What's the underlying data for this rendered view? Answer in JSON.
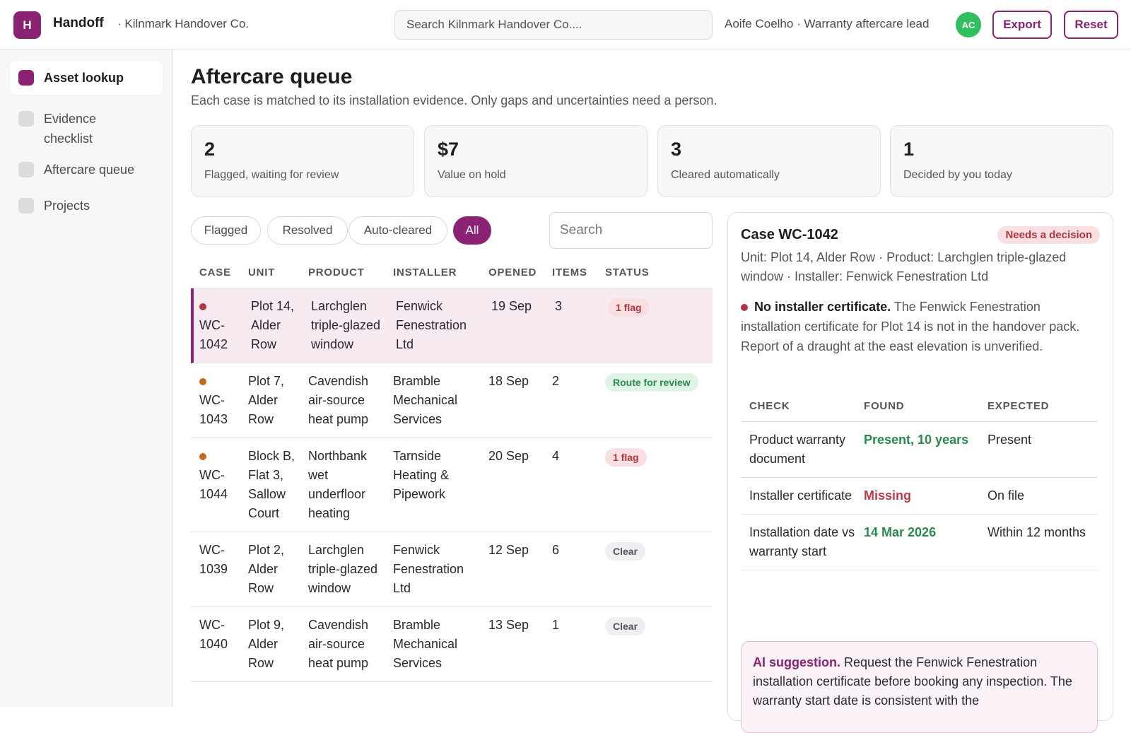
{
  "app": {
    "logo_letter": "H",
    "name": "Handoff",
    "org": "· Kilnmark Handover Co."
  },
  "header": {
    "search_placeholder": "Search Kilnmark Handover Co....",
    "user": "Aoife Coelho · Warranty aftercare lead",
    "avatar_initials": "AC",
    "export_label": "Export",
    "reset_label": "Reset"
  },
  "sidebar": {
    "items": [
      {
        "label": "Asset lookup",
        "active": true
      },
      {
        "label": "Evidence checklist",
        "active": false
      },
      {
        "label": "Aftercare queue",
        "active": false
      },
      {
        "label": "Projects",
        "active": false
      }
    ]
  },
  "page": {
    "title": "Aftercare queue",
    "subtitle": "Each case is matched to its installation evidence. Only gaps and uncertainties need a person."
  },
  "stats": [
    {
      "value": "2",
      "label": "Flagged, waiting for review"
    },
    {
      "value": "$7",
      "label": "Value on hold"
    },
    {
      "value": "3",
      "label": "Cleared automatically"
    },
    {
      "value": "1",
      "label": "Decided by you today"
    }
  ],
  "filters": [
    "Flagged",
    "Resolved",
    "Auto-cleared",
    "All"
  ],
  "active_filter": "All",
  "list_search_placeholder": "Search",
  "table": {
    "columns": [
      "CASE",
      "UNIT",
      "PRODUCT",
      "INSTALLER",
      "OPENED",
      "ITEMS",
      "STATUS"
    ],
    "rows": [
      {
        "case": "WC-1042",
        "unit": "Plot 14, Alder Row",
        "product": "Larchglen triple-glazed window",
        "installer": "Fenwick Fenestration Ltd",
        "opened": "19 Sep",
        "items": "3",
        "status": "1 flag",
        "status_kind": "flag",
        "dot": "#b3343f",
        "selected": true
      },
      {
        "case": "WC-1043",
        "unit": "Plot 7, Alder Row",
        "product": "Cavendish air-source heat pump",
        "installer": "Bramble Mechanical Services",
        "opened": "18 Sep",
        "items": "2",
        "status": "Route for review",
        "status_kind": "review",
        "dot": "#c46a1c",
        "selected": false
      },
      {
        "case": "WC-1044",
        "unit": "Block B, Flat 3, Sallow Court",
        "product": "Northbank wet underfloor heating",
        "installer": "Tarnside Heating & Pipework",
        "opened": "20 Sep",
        "items": "4",
        "status": "1 flag",
        "status_kind": "flag",
        "dot": "#c46a1c",
        "selected": false
      },
      {
        "case": "WC-1039",
        "unit": "Plot 2, Alder Row",
        "product": "Larchglen triple-glazed window",
        "installer": "Fenwick Fenestration Ltd",
        "opened": "12 Sep",
        "items": "6",
        "status": "Clear",
        "status_kind": "clear",
        "dot": "",
        "selected": false
      },
      {
        "case": "WC-1040",
        "unit": "Plot 9, Alder Row",
        "product": "Cavendish air-source heat pump",
        "installer": "Bramble Mechanical Services",
        "opened": "13 Sep",
        "items": "1",
        "status": "Clear",
        "status_kind": "clear",
        "dot": "",
        "selected": false
      }
    ]
  },
  "detail": {
    "title": "Case WC-1042",
    "badge": "Needs a decision",
    "meta": "Unit: Plot 14, Alder Row · Product: Larchglen triple-glazed window · Installer: Fenwick Fenestration Ltd",
    "issue_title": "No installer certificate.",
    "issue_text": " The Fenwick Fenestration installation certificate for Plot 14 is not in the handover pack. Report of a draught at the east elevation is unverified.",
    "columns": [
      "CHECK",
      "FOUND",
      "EXPECTED"
    ],
    "checks": [
      {
        "check": "Product warranty document",
        "found": "Present, 10 years",
        "found_ok": true,
        "expected": "Present"
      },
      {
        "check": "Installer certificate",
        "found": "Missing",
        "found_ok": false,
        "expected": "On file"
      },
      {
        "check": "Installation date vs warranty start",
        "found": "14 Mar 2026",
        "found_ok": true,
        "expected": "Within 12 months"
      }
    ],
    "ai_label": "AI suggestion.",
    "ai_text": " Request the Fenwick Fenestration installation certificate before booking any inspection. The warranty start date is consistent with the"
  },
  "colors": {
    "accent": "#8b2274",
    "flag": "#b3343f",
    "ok": "#2a8a4d",
    "avatar": "#2fbf5f"
  }
}
